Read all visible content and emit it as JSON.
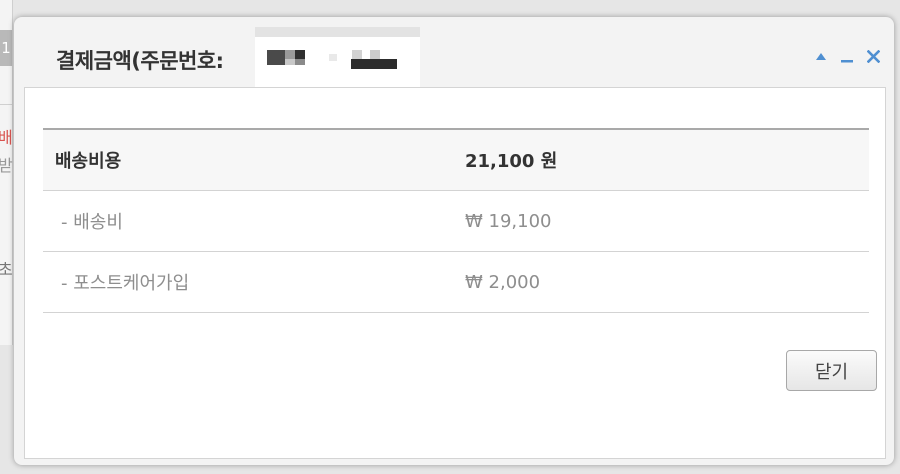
{
  "background": {
    "number_fragment": "1",
    "text_fragments": [
      "배",
      "받",
      "초"
    ]
  },
  "dialog": {
    "title": "결제금액(주문번호:",
    "controls": {
      "collapse_icon": "triangle-up-icon",
      "minimize_icon": "minus-icon",
      "close_icon": "close-x-icon"
    },
    "fees": {
      "total": {
        "label": "배송비용",
        "amount": "21,100 원"
      },
      "items": [
        {
          "label": "- 배송비",
          "amount": "₩ 19,100"
        },
        {
          "label": "- 포스트케어가입",
          "amount": "₩ 2,000"
        }
      ]
    },
    "close_button_label": "닫기"
  },
  "colors": {
    "control_accent": "#4f8fd1",
    "total_text": "#333333",
    "item_text": "#8e8e8e",
    "background_red_text": "#d9534f"
  }
}
